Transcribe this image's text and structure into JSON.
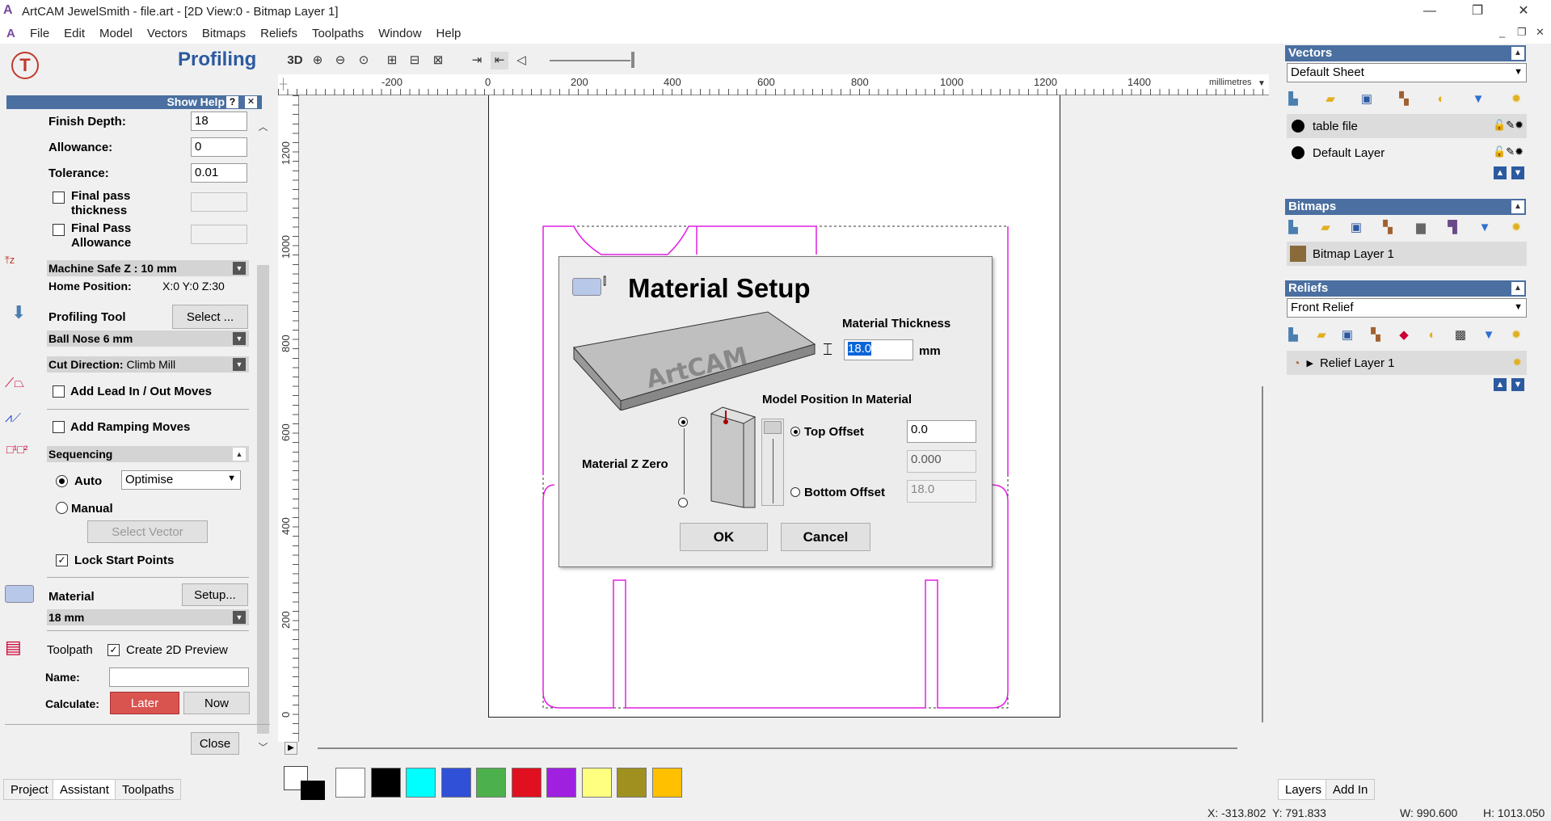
{
  "window": {
    "title": "ArtCAM JewelSmith - file.art - [2D View:0 - Bitmap Layer 1]",
    "min": "—",
    "max": "❐",
    "close": "✕"
  },
  "menu": [
    "File",
    "Edit",
    "Model",
    "Vectors",
    "Bitmaps",
    "Reliefs",
    "Toolpaths",
    "Window",
    "Help"
  ],
  "mdi": {
    "min": "_",
    "restore": "❐",
    "close": "✕"
  },
  "profiling": {
    "title": "Profiling",
    "show_help": "Show Help",
    "help_q": "?",
    "help_x": "✕",
    "finish_depth_label": "Finish Depth:",
    "finish_depth": "18",
    "allowance_label": "Allowance:",
    "allowance": "0",
    "tolerance_label": "Tolerance:",
    "tolerance": "0.01",
    "final_pass_thickness": "Final pass thickness",
    "final_pass_allowance": "Final Pass Allowance",
    "machine_safe_z": "Machine Safe Z : 10 mm",
    "home_position_label": "Home Position:",
    "home_position": "X:0 Y:0 Z:30",
    "profiling_tool_label": "Profiling Tool",
    "select_btn": "Select ...",
    "tool_name": "Ball Nose 6 mm",
    "cut_direction_label": "Cut Direction:",
    "cut_direction": "Climb Mill",
    "add_lead": "Add Lead In / Out Moves",
    "add_ramping": "Add Ramping Moves",
    "sequencing": "Sequencing",
    "auto": "Auto",
    "optimise": "Optimise",
    "manual": "Manual",
    "select_vector": "Select Vector",
    "lock_start": "Lock Start Points",
    "lock_start_check": "✓",
    "material_label": "Material",
    "setup_btn": "Setup...",
    "material_value": "18 mm",
    "toolpath_label": "Toolpath",
    "create_preview": "Create 2D Preview",
    "create_preview_check": "✓",
    "name_label": "Name:",
    "name_value": "",
    "calculate_label": "Calculate:",
    "later_btn": "Later",
    "now_btn": "Now",
    "close_btn": "Close"
  },
  "left_tabs": [
    "Project",
    "Assistant",
    "Toolpaths"
  ],
  "toolbar": {
    "three_d": "3D"
  },
  "ruler": {
    "h_labels": [
      "-200",
      "0",
      "200",
      "400",
      "600",
      "800",
      "1000",
      "1200",
      "1400"
    ],
    "unit": "millimetres",
    "v_labels": [
      "1200",
      "1000",
      "800",
      "600",
      "400",
      "200",
      "0"
    ]
  },
  "palette": {
    "colors": [
      "#ffffff",
      "#000000",
      "#00ffff",
      "#3050d8",
      "#4cb04c",
      "#e01020",
      "#a020e0",
      "#ffff80",
      "#a09020",
      "#ffc000"
    ]
  },
  "vectors_panel": {
    "header": "Vectors",
    "sheet": "Default Sheet",
    "layers": [
      "table file",
      "Default Layer"
    ]
  },
  "bitmaps_panel": {
    "header": "Bitmaps",
    "layer": "Bitmap Layer 1"
  },
  "reliefs_panel": {
    "header": "Reliefs",
    "relief": "Front Relief",
    "layer": "Relief Layer 1"
  },
  "right_tabs": [
    "Layers",
    "Add In"
  ],
  "dialog": {
    "title": "Material Setup",
    "material_thickness_label": "Material Thickness",
    "thickness": "18.0",
    "unit": "mm",
    "model_position_label": "Model Position In Material",
    "material_z_zero": "Material Z Zero",
    "top_offset_label": "Top Offset",
    "top_offset": "0.0",
    "middle_value": "0.000",
    "bottom_offset_label": "Bottom Offset",
    "bottom_offset": "18.0",
    "ok": "OK",
    "cancel": "Cancel"
  },
  "status": {
    "x": "X: -313.802",
    "y": "Y: 791.833",
    "w": "W: 990.600",
    "h": "H: 1013.050"
  }
}
